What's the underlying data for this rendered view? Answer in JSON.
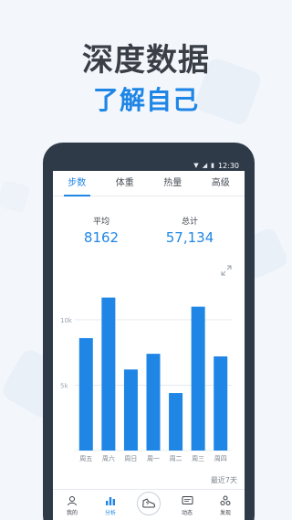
{
  "headline": "深度数据",
  "subline": "了解自己",
  "statusbar": {
    "time": "12:30"
  },
  "tabs": [
    {
      "label": "步数",
      "active": true
    },
    {
      "label": "体重",
      "active": false
    },
    {
      "label": "热量",
      "active": false
    },
    {
      "label": "高级",
      "active": false
    }
  ],
  "stats": {
    "average_label": "平均",
    "average_value": "8162",
    "total_label": "总计",
    "total_value": "57,134"
  },
  "chart_data": {
    "type": "bar",
    "categories": [
      "周五",
      "周六",
      "周日",
      "周一",
      "周二",
      "周三",
      "周四"
    ],
    "values": [
      8600,
      11700,
      6200,
      7400,
      4400,
      11000,
      7200
    ],
    "y_ticks": [
      "10k",
      "5k"
    ],
    "y_tick_values": [
      10000,
      5000
    ],
    "ylim": [
      0,
      13000
    ],
    "grid": true,
    "bar_color": "#1f86e6"
  },
  "recent_label": "最近7天",
  "navbar": [
    {
      "label": "我的",
      "icon": "person-icon",
      "active": false
    },
    {
      "label": "分析",
      "icon": "bar-chart-icon",
      "active": true
    },
    {
      "label": "",
      "icon": "shoe-icon",
      "active": false
    },
    {
      "label": "动态",
      "icon": "message-icon",
      "active": false
    },
    {
      "label": "发现",
      "icon": "discover-icon",
      "active": false
    }
  ],
  "colors": {
    "accent": "#1f86e6",
    "phone_frame": "#2f3a48",
    "background": "#f3f7fc"
  }
}
